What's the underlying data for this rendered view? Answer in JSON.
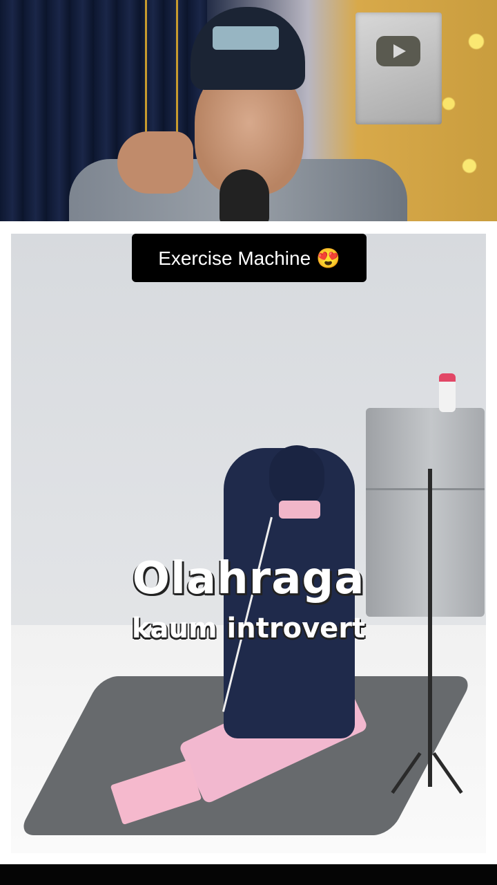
{
  "caption": {
    "text": "Exercise Machine 😍"
  },
  "overlay": {
    "title": "Olahraga",
    "subtitle": "kaum introvert"
  },
  "colors": {
    "caption_bg": "#000000",
    "caption_text": "#ffffff",
    "page_bg": "#ffffff"
  }
}
